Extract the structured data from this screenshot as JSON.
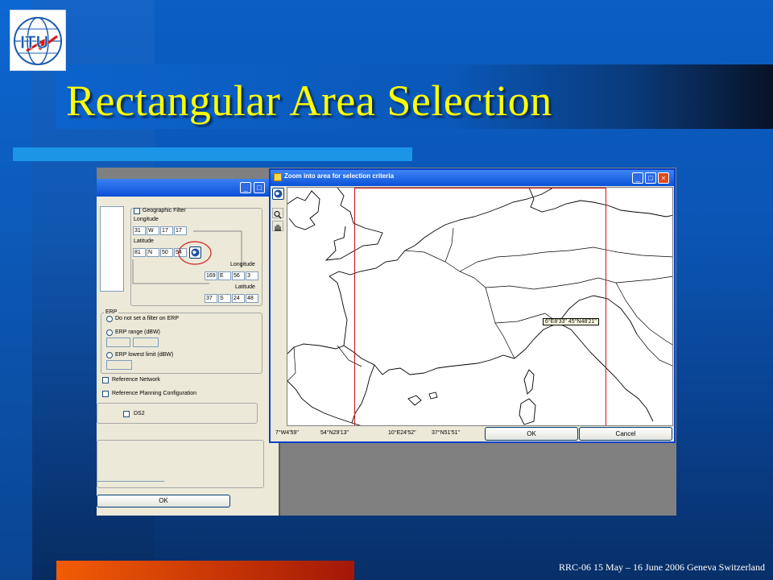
{
  "slide": {
    "title": "Rectangular Area Selection",
    "footer": "RRC-06 15 May – 16 June 2006 Geneva Switzerland",
    "logo_text": "ITU",
    "colors": {
      "title": "#ffff00",
      "accent_rule": "#1b96e6",
      "orange_bar": "#f25c05"
    }
  },
  "back_dialog": {
    "geographic_filter_label": "Geographic Filter",
    "longitude_label": "Longitude",
    "longitude_values": [
      "31",
      "W",
      "17",
      "17"
    ],
    "latitude_label": "Latitude",
    "latitude_values": [
      "81",
      "N",
      "50",
      "54"
    ],
    "longitude2_label": "Longitude",
    "longitude2_values": [
      "169",
      "E",
      "56",
      "3"
    ],
    "latitude2_label": "Latitude",
    "latitude2_values": [
      "37",
      "S",
      "24",
      "48"
    ],
    "erp_group_label": "ERP",
    "erp_no_filter_label": "Do not set a filter on ERP",
    "erp_range_label": "ERP range (dBW)",
    "erp_lowest_label": "ERP lowest limit (dBW)",
    "reference_network_label": "Reference Network",
    "reference_planning_label": "Reference Planning Configuration",
    "ds2_label": "DS2",
    "ok_label": "OK"
  },
  "map_window": {
    "title": "Zoom into area for selection criteria",
    "tooltip": "6°E8'33\" 45°N48'21\"",
    "status": [
      "7°W4'59\"",
      "54°N29'13\"",
      "10°E24'52\"",
      "37°N51'51\""
    ],
    "ok_label": "OK",
    "cancel_label": "Cancel",
    "tools": [
      "globe-icon",
      "zoom-icon",
      "hand-icon"
    ]
  }
}
